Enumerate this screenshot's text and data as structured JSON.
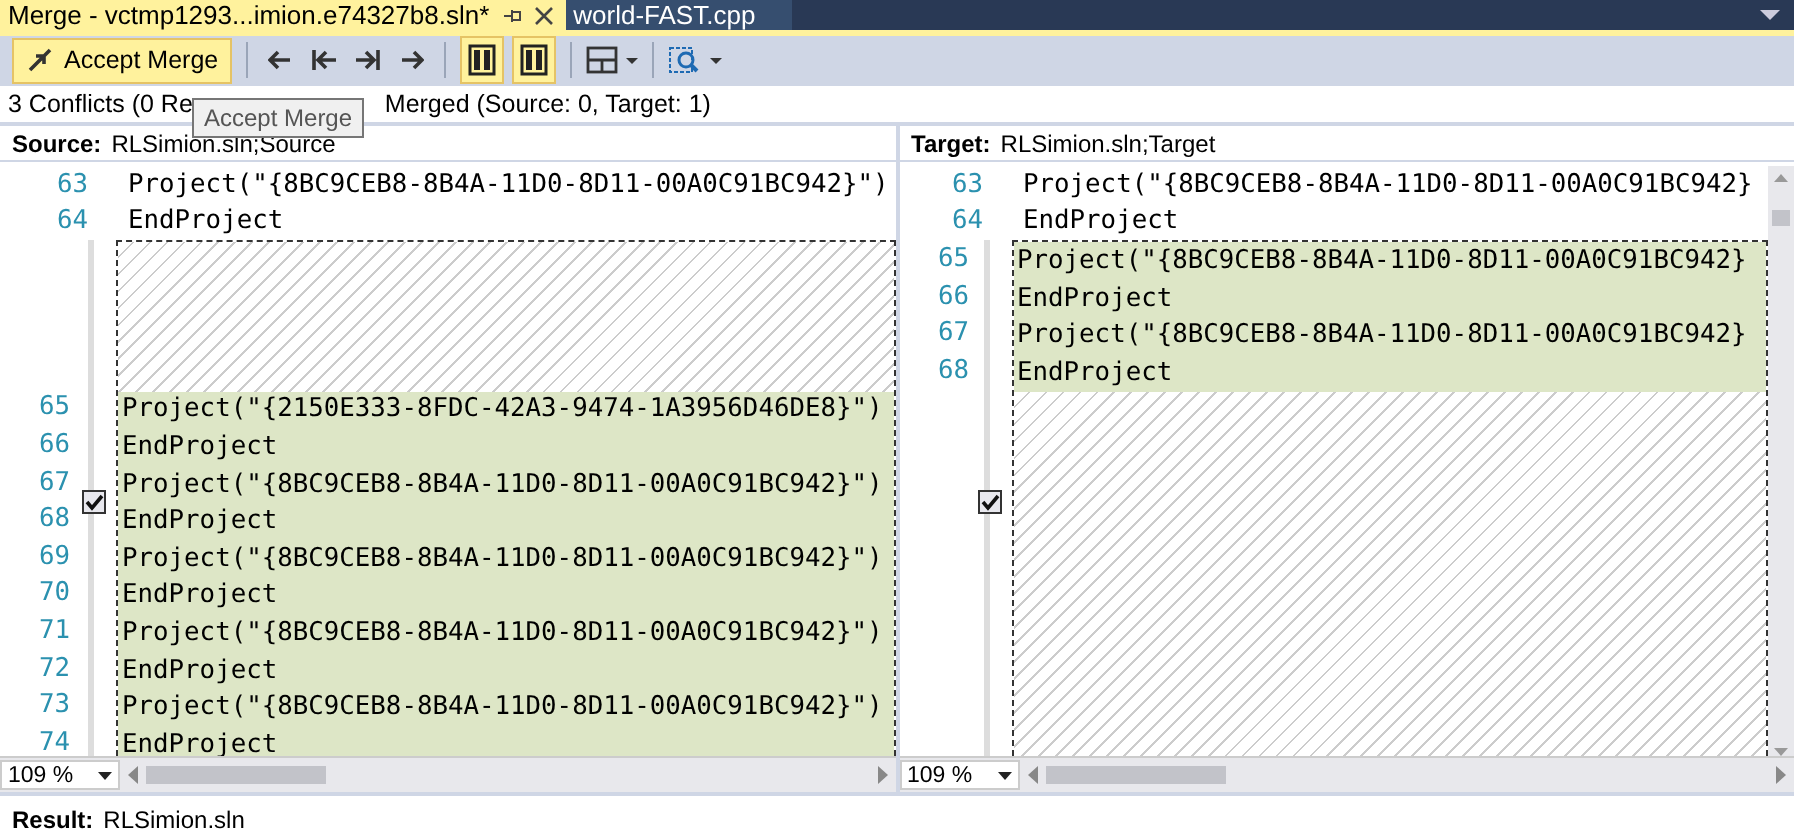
{
  "tabs": [
    {
      "label": "Merge - vctmp1293...imion.e74327b8.sln*",
      "selected": true
    },
    {
      "label": "world-FAST.cpp",
      "selected": false
    }
  ],
  "toolbar": {
    "accept_button": "Accept Merge",
    "tooltip": "Accept Merge"
  },
  "status": {
    "text_before": "3 Conflicts (0 Re",
    "text_after": "Merged (Source: 0, Target: 1)"
  },
  "panes": [
    {
      "label": "Source:",
      "file": "RLSimion.sln;Source",
      "zoom": "109 %",
      "blocks": [
        {
          "kind": "plain",
          "lines": [
            {
              "number": "63",
              "text": "Project(\"{8BC9CEB8-8B4A-11D0-8D11-00A0C91BC942}\")"
            },
            {
              "number": "64",
              "text": "EndProject"
            }
          ]
        },
        {
          "kind": "conflict",
          "checked": true,
          "parts": [
            {
              "kind": "hatch"
            },
            {
              "kind": "lines",
              "lines": [
                {
                  "number": "65",
                  "text": "Project(\"{2150E333-8FDC-42A3-9474-1A3956D46DE8}\")"
                },
                {
                  "number": "66",
                  "text": "EndProject"
                },
                {
                  "number": "67",
                  "text": "Project(\"{8BC9CEB8-8B4A-11D0-8D11-00A0C91BC942}\")"
                },
                {
                  "number": "68",
                  "text": "EndProject"
                },
                {
                  "number": "69",
                  "text": "Project(\"{8BC9CEB8-8B4A-11D0-8D11-00A0C91BC942}\")"
                },
                {
                  "number": "70",
                  "text": "EndProject"
                },
                {
                  "number": "71",
                  "text": "Project(\"{8BC9CEB8-8B4A-11D0-8D11-00A0C91BC942}\")"
                },
                {
                  "number": "72",
                  "text": "EndProject"
                },
                {
                  "number": "73",
                  "text": "Project(\"{8BC9CEB8-8B4A-11D0-8D11-00A0C91BC942}\")"
                },
                {
                  "number": "74",
                  "text": "EndProject"
                }
              ]
            }
          ]
        }
      ]
    },
    {
      "label": "Target:",
      "file": "RLSimion.sln;Target",
      "zoom": "109 %",
      "blocks": [
        {
          "kind": "plain",
          "lines": [
            {
              "number": "63",
              "text": "Project(\"{8BC9CEB8-8B4A-11D0-8D11-00A0C91BC942}"
            },
            {
              "number": "64",
              "text": "EndProject"
            }
          ]
        },
        {
          "kind": "conflict",
          "checked": true,
          "parts": [
            {
              "kind": "lines",
              "lines": [
                {
                  "number": "65",
                  "text": "Project(\"{8BC9CEB8-8B4A-11D0-8D11-00A0C91BC942}"
                },
                {
                  "number": "66",
                  "text": "EndProject"
                },
                {
                  "number": "67",
                  "text": "Project(\"{8BC9CEB8-8B4A-11D0-8D11-00A0C91BC942}"
                },
                {
                  "number": "68",
                  "text": "EndProject"
                }
              ]
            },
            {
              "kind": "hatch"
            }
          ]
        }
      ]
    }
  ],
  "result": {
    "label": "Result:",
    "file": "RLSimion.sln"
  }
}
